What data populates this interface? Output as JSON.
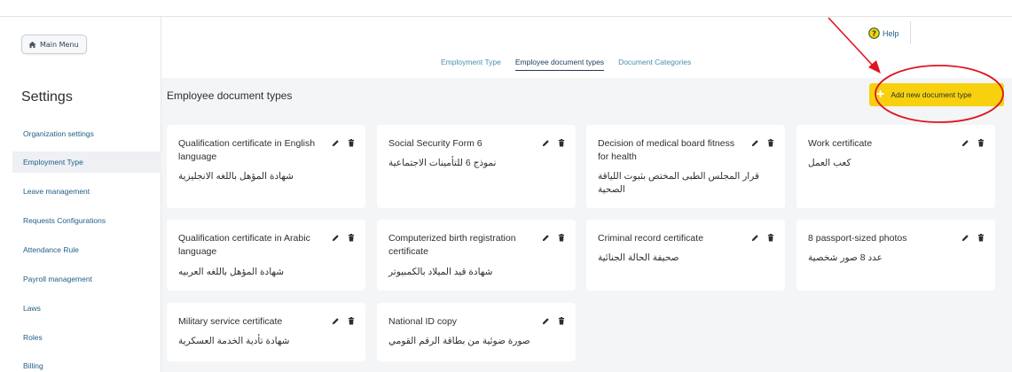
{
  "sidebar": {
    "main_menu_label": "Main Menu",
    "title": "Settings",
    "items": [
      {
        "label": "Organization settings",
        "active": false
      },
      {
        "label": "Employment Type",
        "active": true
      },
      {
        "label": "Leave management",
        "active": false
      },
      {
        "label": "Requests Configurations",
        "active": false
      },
      {
        "label": "Attendance Rule",
        "active": false
      },
      {
        "label": "Payroll management",
        "active": false
      },
      {
        "label": "Laws",
        "active": false
      },
      {
        "label": "Roles",
        "active": false
      },
      {
        "label": "Billing",
        "active": false
      }
    ]
  },
  "header": {
    "help_label": "Help",
    "tabs": [
      {
        "label": "Employment Type",
        "active": false
      },
      {
        "label": "Employee document types",
        "active": true
      },
      {
        "label": "Document Categories",
        "active": false
      }
    ]
  },
  "main": {
    "title": "Employee document types",
    "add_button_label": "Add new document type",
    "cards": [
      {
        "en": "Qualification certificate in English language",
        "ar": "شهادة المؤهل باللغه الانجليزية"
      },
      {
        "en": "Social Security Form 6",
        "ar": "نموذج 6 للتأمينات الاجتماعية"
      },
      {
        "en": "Decision of medical board fitness for health",
        "ar": "قرار المجلس الطبى المختص بثبوت اللياقة الصحية"
      },
      {
        "en": "Work certificate",
        "ar": "كعب العمل"
      },
      {
        "en": "Qualification certificate in Arabic language",
        "ar": "شهادة المؤهل باللغه العربيه"
      },
      {
        "en": "Computerized birth registration certificate",
        "ar": "شهادة قيد الميلاد بالكمبيوتر"
      },
      {
        "en": "Criminal record certificate",
        "ar": "صحيفة الحالة الجنائية"
      },
      {
        "en": "8 passport-sized photos",
        "ar": "عدد 8 صور شخصية"
      },
      {
        "en": "Military service certificate",
        "ar": "شهادة تأدية الخدمة العسكرية"
      },
      {
        "en": "National ID copy",
        "ar": "صورة ضوئية من بطاقة الرقم القومي"
      }
    ]
  },
  "colors": {
    "accent_yellow": "#f7d10d",
    "link_blue": "#1f5f86",
    "annotation_red": "#e0141e"
  },
  "icons": [
    "home-icon",
    "help-icon",
    "plus-icon",
    "pencil-icon",
    "trash-icon"
  ]
}
